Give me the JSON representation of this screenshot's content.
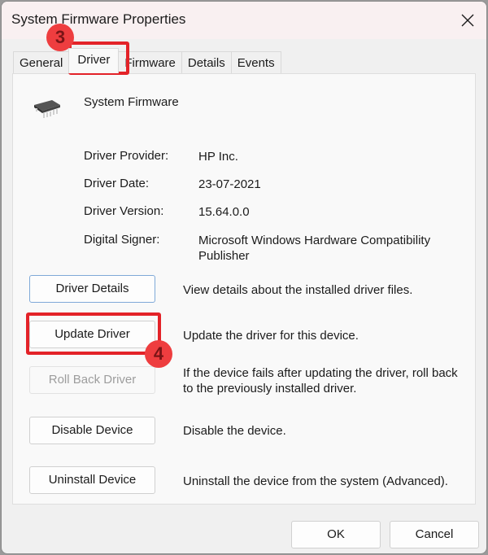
{
  "window": {
    "title": "System Firmware Properties",
    "close_icon": "close-icon"
  },
  "tabs": [
    {
      "label": "General",
      "active": false
    },
    {
      "label": "Driver",
      "active": true
    },
    {
      "label": "Firmware",
      "active": false
    },
    {
      "label": "Details",
      "active": false
    },
    {
      "label": "Events",
      "active": false
    }
  ],
  "device": {
    "icon": "chip-icon",
    "name": "System Firmware"
  },
  "properties": [
    {
      "label": "Driver Provider:",
      "value": "HP Inc."
    },
    {
      "label": "Driver Date:",
      "value": "23-07-2021"
    },
    {
      "label": "Driver Version:",
      "value": "15.64.0.0"
    },
    {
      "label": "Digital Signer:",
      "value": "Microsoft Windows Hardware Compatibility Publisher"
    }
  ],
  "actions": [
    {
      "label": "Driver Details",
      "description": "View details about the installed driver files.",
      "enabled": true
    },
    {
      "label": "Update Driver",
      "description": "Update the driver for this device.",
      "enabled": true
    },
    {
      "label": "Roll Back Driver",
      "description": "If the device fails after updating the driver, roll back to the previously installed driver.",
      "enabled": false
    },
    {
      "label": "Disable Device",
      "description": "Disable the device.",
      "enabled": true
    },
    {
      "label": "Uninstall Device",
      "description": "Uninstall the device from the system (Advanced).",
      "enabled": true
    }
  ],
  "footer": {
    "ok_label": "OK",
    "cancel_label": "Cancel"
  },
  "annotations": {
    "step_3": "3",
    "step_4": "4",
    "highlight_color": "#e32228",
    "badge_color": "#ee3d3f"
  }
}
